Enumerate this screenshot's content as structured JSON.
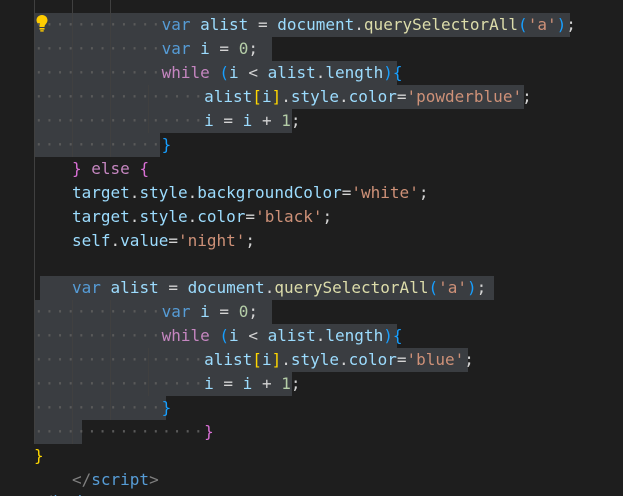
{
  "editor": {
    "lines": [
      {
        "id": "l1",
        "tokens": [
          [
            "kw",
            "var"
          ],
          [
            "op",
            " "
          ],
          [
            "var",
            "alist"
          ],
          [
            "op",
            " = "
          ],
          [
            "var",
            "document"
          ],
          [
            "op",
            "."
          ],
          [
            "fn",
            "querySelectorAll"
          ],
          [
            "brace3",
            "("
          ],
          [
            "str",
            "'a'"
          ],
          [
            "brace3",
            ")"
          ],
          [
            "op",
            ";"
          ]
        ]
      },
      {
        "id": "l2",
        "tokens": [
          [
            "kw",
            "var"
          ],
          [
            "op",
            " "
          ],
          [
            "var",
            "i"
          ],
          [
            "op",
            " = "
          ],
          [
            "num",
            "0"
          ],
          [
            "op",
            ";"
          ]
        ]
      },
      {
        "id": "l3",
        "tokens": [
          [
            "ctl",
            "while"
          ],
          [
            "op",
            " "
          ],
          [
            "brace3",
            "("
          ],
          [
            "var",
            "i"
          ],
          [
            "op",
            " < "
          ],
          [
            "var",
            "alist"
          ],
          [
            "op",
            "."
          ],
          [
            "var",
            "length"
          ],
          [
            "brace3",
            ")"
          ],
          [
            "brace3",
            "{"
          ]
        ]
      },
      {
        "id": "l4",
        "tokens": [
          [
            "var",
            "alist"
          ],
          [
            "brace1",
            "["
          ],
          [
            "var",
            "i"
          ],
          [
            "brace1",
            "]"
          ],
          [
            "op",
            "."
          ],
          [
            "var",
            "style"
          ],
          [
            "op",
            "."
          ],
          [
            "var",
            "color"
          ],
          [
            "op",
            "="
          ],
          [
            "str",
            "'powderblue'"
          ],
          [
            "op",
            ";"
          ]
        ]
      },
      {
        "id": "l5",
        "tokens": [
          [
            "var",
            "i"
          ],
          [
            "op",
            " = "
          ],
          [
            "var",
            "i"
          ],
          [
            "op",
            " + "
          ],
          [
            "num",
            "1"
          ],
          [
            "op",
            ";"
          ]
        ]
      },
      {
        "id": "l6",
        "tokens": [
          [
            "brace3",
            "}"
          ]
        ]
      },
      {
        "id": "l7",
        "tokens": [
          [
            "brace2",
            "}"
          ],
          [
            "op",
            " "
          ],
          [
            "ctl",
            "else"
          ],
          [
            "op",
            " "
          ],
          [
            "brace2",
            "{"
          ]
        ]
      },
      {
        "id": "l8",
        "tokens": [
          [
            "var",
            "target"
          ],
          [
            "op",
            "."
          ],
          [
            "var",
            "style"
          ],
          [
            "op",
            "."
          ],
          [
            "var",
            "backgroundColor"
          ],
          [
            "op",
            "="
          ],
          [
            "str",
            "'white'"
          ],
          [
            "op",
            ";"
          ]
        ]
      },
      {
        "id": "l9",
        "tokens": [
          [
            "var",
            "target"
          ],
          [
            "op",
            "."
          ],
          [
            "var",
            "style"
          ],
          [
            "op",
            "."
          ],
          [
            "var",
            "color"
          ],
          [
            "op",
            "="
          ],
          [
            "str",
            "'black'"
          ],
          [
            "op",
            ";"
          ]
        ]
      },
      {
        "id": "l10",
        "tokens": [
          [
            "var",
            "self"
          ],
          [
            "op",
            "."
          ],
          [
            "var",
            "value"
          ],
          [
            "op",
            "="
          ],
          [
            "str",
            "'night'"
          ],
          [
            "op",
            ";"
          ]
        ]
      },
      {
        "id": "l11",
        "tokens": []
      },
      {
        "id": "l12",
        "tokens": [
          [
            "kw",
            "var"
          ],
          [
            "op",
            " "
          ],
          [
            "var",
            "alist"
          ],
          [
            "op",
            " = "
          ],
          [
            "var",
            "document"
          ],
          [
            "op",
            "."
          ],
          [
            "fn",
            "querySelectorAll"
          ],
          [
            "brace3",
            "("
          ],
          [
            "str",
            "'a'"
          ],
          [
            "brace3",
            ")"
          ],
          [
            "op",
            ";"
          ]
        ]
      },
      {
        "id": "l13",
        "tokens": [
          [
            "kw",
            "var"
          ],
          [
            "op",
            " "
          ],
          [
            "var",
            "i"
          ],
          [
            "op",
            " = "
          ],
          [
            "num",
            "0"
          ],
          [
            "op",
            ";"
          ]
        ]
      },
      {
        "id": "l14",
        "tokens": [
          [
            "ctl",
            "while"
          ],
          [
            "op",
            " "
          ],
          [
            "brace3",
            "("
          ],
          [
            "var",
            "i"
          ],
          [
            "op",
            " < "
          ],
          [
            "var",
            "alist"
          ],
          [
            "op",
            "."
          ],
          [
            "var",
            "length"
          ],
          [
            "brace3",
            ")"
          ],
          [
            "brace3",
            "{"
          ]
        ]
      },
      {
        "id": "l15",
        "tokens": [
          [
            "var",
            "alist"
          ],
          [
            "brace1",
            "["
          ],
          [
            "var",
            "i"
          ],
          [
            "brace1",
            "]"
          ],
          [
            "op",
            "."
          ],
          [
            "var",
            "style"
          ],
          [
            "op",
            "."
          ],
          [
            "var",
            "color"
          ],
          [
            "op",
            "="
          ],
          [
            "str",
            "'blue'"
          ],
          [
            "op",
            ";"
          ]
        ]
      },
      {
        "id": "l16",
        "tokens": [
          [
            "var",
            "i"
          ],
          [
            "op",
            " = "
          ],
          [
            "var",
            "i"
          ],
          [
            "op",
            " + "
          ],
          [
            "num",
            "1"
          ],
          [
            "op",
            ";"
          ]
        ]
      },
      {
        "id": "l17",
        "tokens": [
          [
            "brace3",
            "}"
          ]
        ]
      },
      {
        "id": "l18",
        "tokens": [
          [
            "brace2",
            "}"
          ]
        ]
      },
      {
        "id": "l19",
        "tokens": [
          [
            "brace1",
            "}"
          ]
        ]
      },
      {
        "id": "l20",
        "tokens": [
          [
            "tag",
            "</"
          ],
          [
            "tagname",
            "script"
          ],
          [
            "tag",
            ">"
          ]
        ]
      },
      {
        "id": "l21",
        "tokens": [
          [
            "tag",
            "</"
          ],
          [
            "tagname",
            "body"
          ],
          [
            "tag",
            ">"
          ]
        ]
      }
    ]
  },
  "icons": {
    "lightbulb": "lightbulb-icon"
  },
  "colors": {
    "background": "#1e1e1e",
    "selection": "#3a3d41",
    "keyword": "#569cd6",
    "control": "#c586c0",
    "variable": "#9cdcfe",
    "function": "#dcdcaa",
    "string": "#ce9178",
    "number": "#b5cea8"
  }
}
